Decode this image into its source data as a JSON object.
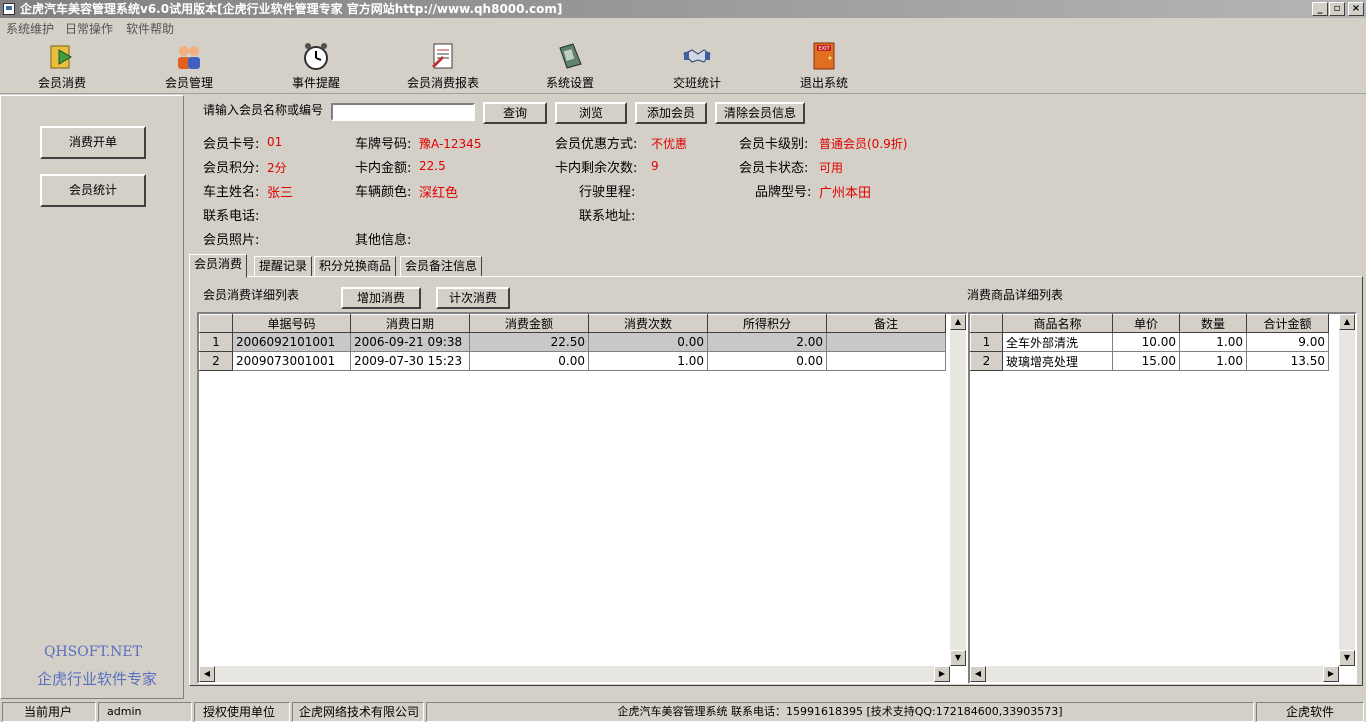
{
  "window": {
    "title": "企虎汽车美容管理系统v6.0试用版本[企虎行业软件管理专家 官方网站http://www.qh8000.com]"
  },
  "menu": [
    "系统维护",
    "日常操作",
    "软件帮助"
  ],
  "toolbar": [
    {
      "label": "会员消费",
      "icon": "arrow-icon"
    },
    {
      "label": "会员管理",
      "icon": "users-icon"
    },
    {
      "label": "事件提醒",
      "icon": "alarm-clock-icon"
    },
    {
      "label": "会员消费报表",
      "icon": "report-icon"
    },
    {
      "label": "系统设置",
      "icon": "settings-book-icon"
    },
    {
      "label": "交班统计",
      "icon": "handshake-icon"
    },
    {
      "label": "退出系统",
      "icon": "exit-door-icon"
    }
  ],
  "left": {
    "btn_order": "消费开单",
    "btn_stats": "会员统计",
    "brand_en": "QHSOFT.NET",
    "brand_cn": "企虎行业软件专家"
  },
  "search": {
    "label": "请输入会员名称或编号",
    "value": "",
    "query": "查询",
    "browse": "浏览",
    "add": "添加会员",
    "clear": "清除会员信息"
  },
  "member": {
    "card_no_label": "会员卡号:",
    "card_no": "01",
    "plate_label": "车牌号码:",
    "plate": "豫A-12345",
    "discount_label": "会员优惠方式:",
    "discount": "不优惠",
    "level_label": "会员卡级别:",
    "level": "普通会员(0.9折)",
    "points_label": "会员积分:",
    "points": "2分",
    "balance_label": "卡内金额:",
    "balance": "22.5",
    "remain_label": "卡内剩余次数:",
    "remain": "9",
    "status_label": "会员卡状态:",
    "status": "可用",
    "owner_label": "车主姓名:",
    "owner": "张三",
    "color_label": "车辆颜色:",
    "color": "深红色",
    "mileage_label": "行驶里程:",
    "mileage": "",
    "brand_label": "品牌型号:",
    "brand": "广州本田",
    "phone_label": "联系电话:",
    "phone": "",
    "address_label": "联系地址:",
    "address": "",
    "photo_label": "会员照片:",
    "other_label": "其他信息:",
    "other": ""
  },
  "tabs": [
    "会员消费",
    "提醒记录",
    "积分兑换商品",
    "会员备注信息"
  ],
  "consume": {
    "title": "会员消费详细列表",
    "add_btn": "增加消费",
    "count_btn": "计次消费",
    "columns": [
      "单据号码",
      "消费日期",
      "消费金额",
      "消费次数",
      "所得积分",
      "备注"
    ],
    "rows": [
      {
        "idx": "1",
        "no": "2006092101001",
        "date": "2006-09-21 09:38",
        "amount": "22.50",
        "times": "0.00",
        "points": "2.00",
        "note": ""
      },
      {
        "idx": "2",
        "no": "2009073001001",
        "date": "2009-07-30 15:23",
        "amount": "0.00",
        "times": "1.00",
        "points": "0.00",
        "note": ""
      }
    ]
  },
  "goods": {
    "title": "消费商品详细列表",
    "columns": [
      "商品名称",
      "单价",
      "数量",
      "合计金额"
    ],
    "rows": [
      {
        "idx": "1",
        "name": "全车外部清洗",
        "price": "10.00",
        "qty": "1.00",
        "total": "9.00"
      },
      {
        "idx": "2",
        "name": "玻璃增亮处理",
        "price": "15.00",
        "qty": "1.00",
        "total": "13.50"
      }
    ]
  },
  "status": {
    "user_label": "当前用户",
    "user": "admin",
    "unit_label": "授权使用单位",
    "unit": "企虎网络技术有限公司",
    "info": "企虎汽车美容管理系统 联系电话：15991618395 [技术支持QQ:172184600,33903573]",
    "vendor": "企虎软件"
  }
}
